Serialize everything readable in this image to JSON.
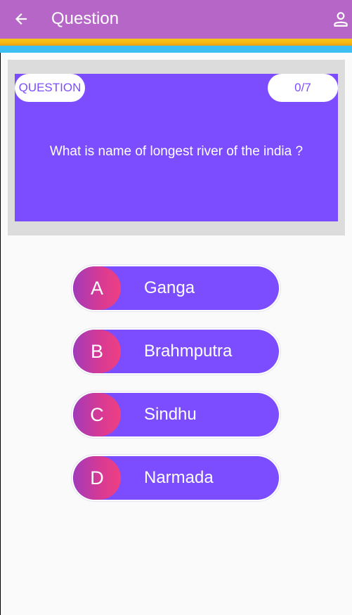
{
  "appbar": {
    "title": "Question",
    "back_icon": "arrow-left-icon",
    "profile_icon": "person-icon"
  },
  "question": {
    "tag_label": "QUESTION",
    "counter": "0/7",
    "text": "What is name of longest river of the india ?"
  },
  "options": [
    {
      "letter": "A",
      "text": "Ganga"
    },
    {
      "letter": "B",
      "text": "Brahmputra"
    },
    {
      "letter": "C",
      "text": "Sindhu"
    },
    {
      "letter": "D",
      "text": "Narmada"
    }
  ],
  "colors": {
    "appbar": "#b566c6",
    "accent": "#7c4dff",
    "stripe_yellow": "#f5b814",
    "stripe_blue": "#3cbef2"
  }
}
